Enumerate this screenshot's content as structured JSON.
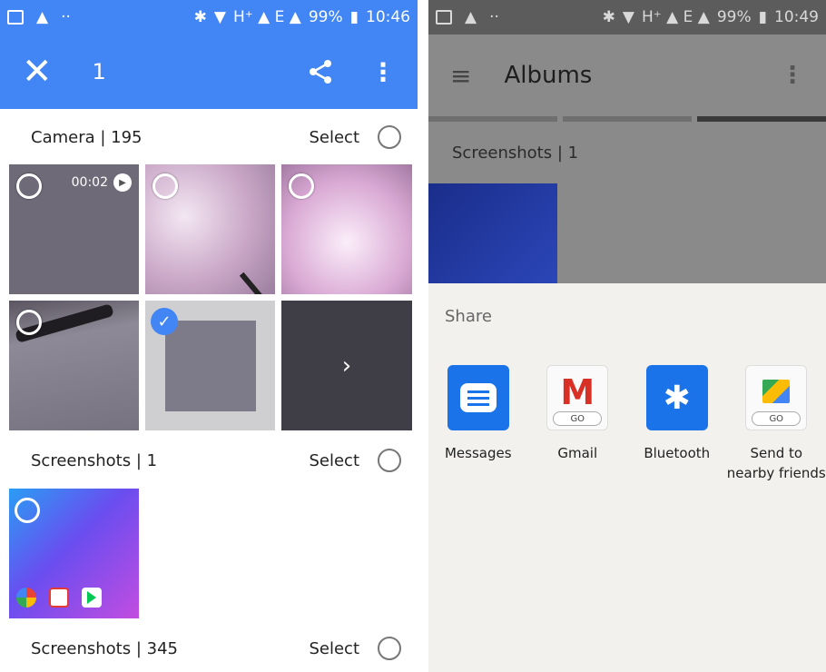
{
  "left": {
    "status_bar": {
      "battery": "99%",
      "time": "10:46",
      "network": "H⁺ ▲ E ▲"
    },
    "toolbar": {
      "close_icon": "✕",
      "count": "1",
      "share_icon": "share-icon",
      "more_icon": "⋮"
    },
    "sections": [
      {
        "title": "Camera | 195",
        "select": "Select"
      },
      {
        "title": "Screenshots | 1",
        "select": "Select"
      },
      {
        "title": "Screenshots | 345",
        "select": "Select"
      }
    ],
    "camera_tiles": {
      "video_duration": "00:02",
      "more_chevron": "›"
    }
  },
  "right": {
    "status_bar": {
      "battery": "99%",
      "time": "10:49",
      "network": "H⁺ ▲ E ▲"
    },
    "toolbar": {
      "menu_icon": "≡",
      "title": "Albums",
      "more_icon": "⋮"
    },
    "section": {
      "title": "Screenshots | 1"
    },
    "share_sheet": {
      "title": "Share",
      "apps": [
        {
          "label": "Messages"
        },
        {
          "label": "Gmail",
          "badge": "GO"
        },
        {
          "label": "Bluetooth"
        },
        {
          "label": "Send to nearby friends",
          "badge": "GO"
        }
      ]
    }
  },
  "colors": {
    "accent": "#4285f4",
    "selected_check": "#4285f4"
  }
}
